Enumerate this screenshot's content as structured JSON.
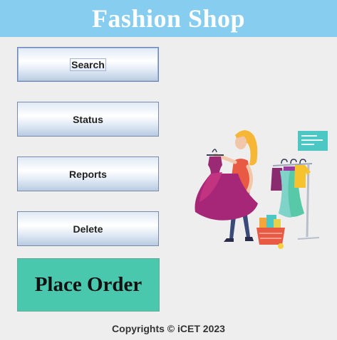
{
  "app": {
    "title": "Fashion Shop"
  },
  "menu": {
    "search_label": "Search",
    "status_label": "Status",
    "reports_label": "Reports",
    "delete_label": "Delete",
    "place_order_label": "Place Order"
  },
  "footer": {
    "copyright": "Copyrights © iCET 2023"
  },
  "colors": {
    "title_bar": "#87cdef",
    "place_order_bg": "#4ac8ae",
    "window_bg": "#eeeeee"
  },
  "illustration": {
    "icon": "shopping-woman-with-dress-illustration"
  }
}
